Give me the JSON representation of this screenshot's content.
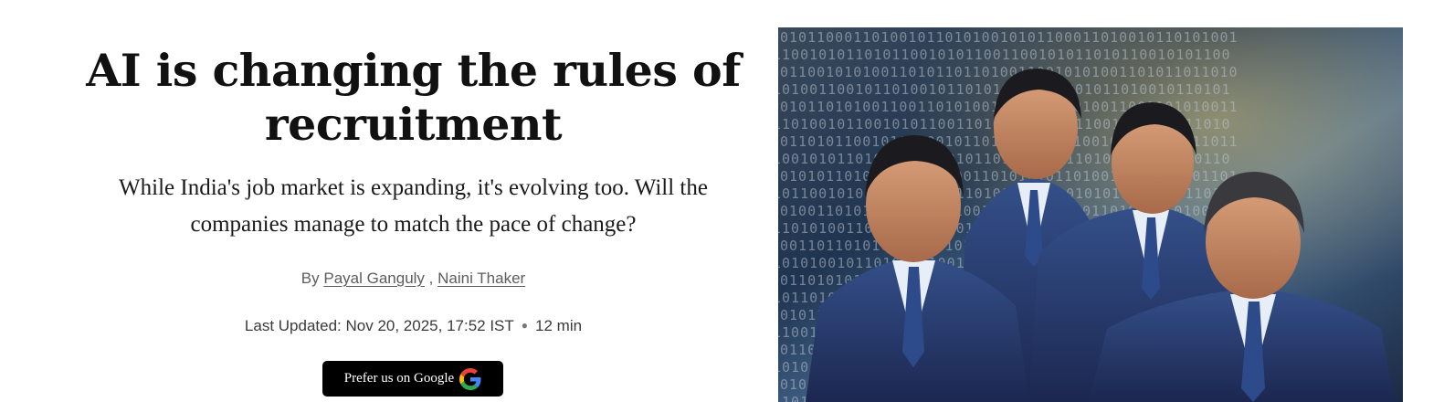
{
  "article": {
    "headline": "AI is changing the rules of recruitment",
    "subheadline": "While India's job market is expanding, it's evolving too. Will the companies manage to match the pace of change?",
    "byline": {
      "prefix": "By",
      "separator": ",",
      "authors": [
        "Payal Ganguly",
        "Naini Thaker"
      ]
    },
    "last_updated": "Last Updated: Nov 20, 2025, 17:52 IST",
    "read_time": "12 min"
  },
  "prefer_button": {
    "label": "Prefer us on Google",
    "icon": "google-g-icon"
  },
  "hero_image": {
    "subject": "four-executives-in-suits-illustration",
    "binary_rows": [
      "0101100011010010110101001",
      "1100101011010110010101100",
      "0110010101001101011011010",
      "1010011001011010010110101",
      "0101101010011001101010011",
      "1101001011001010110011010",
      "0110101100101011001011011",
      "1001010110101001101010110",
      "0101011010010110101001101",
      "1011001010101101001011010",
      "0100110101101010110100101",
      "1101010011010101001101011",
      "0011011010101100101010110",
      "1010100101101011010011010",
      "0110101011001010110101001",
      "1011010100110101001011011",
      "0101101011010010110101100",
      "1100101101001011010010101",
      "0110100101101010011011010",
      "1010110101001101011010011",
      "0101011010110100101101010",
      "1101001101010110101001101"
    ]
  },
  "colors": {
    "text_primary": "#111111",
    "text_muted": "#5c5c5c",
    "button_bg": "#000000",
    "button_text": "#ffffff",
    "suit": "#26366a",
    "background_blue": "#1d2c3f"
  }
}
